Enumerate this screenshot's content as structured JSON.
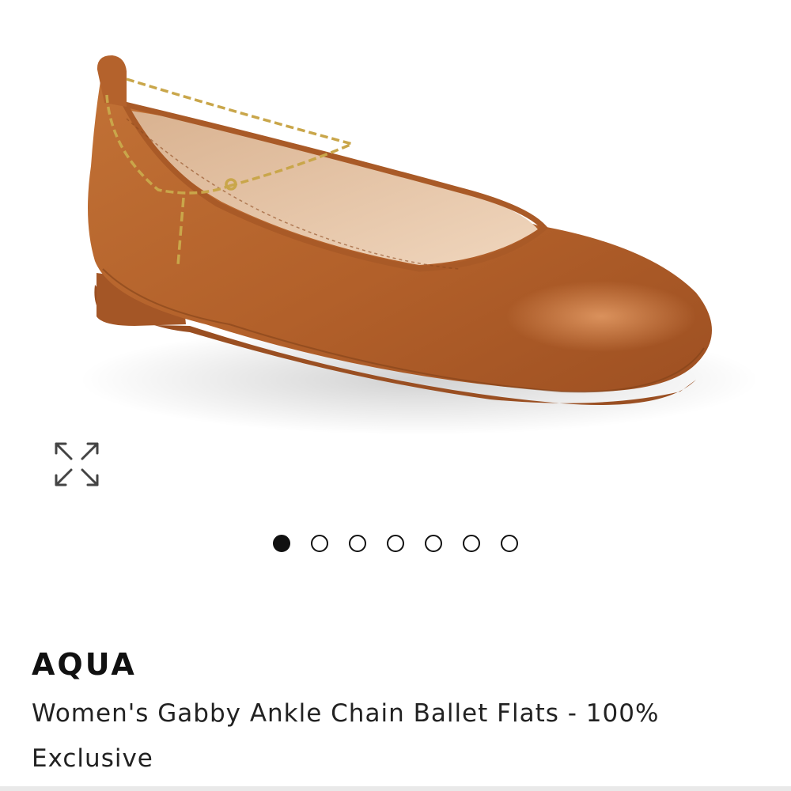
{
  "gallery": {
    "image_alt": "Women's Gabby Ankle Chain Ballet Flats",
    "expand_icon": "expand-arrows-icon",
    "slide_count": 7,
    "active_slide": 1
  },
  "product": {
    "brand": "AQUA",
    "title": "Women's Gabby Ankle Chain Ballet Flats - 100% Exclusive"
  },
  "colors": {
    "leather": "#b8662e",
    "lining": "#e8c7a9",
    "chain": "#c9a64a",
    "text": "#111111"
  }
}
